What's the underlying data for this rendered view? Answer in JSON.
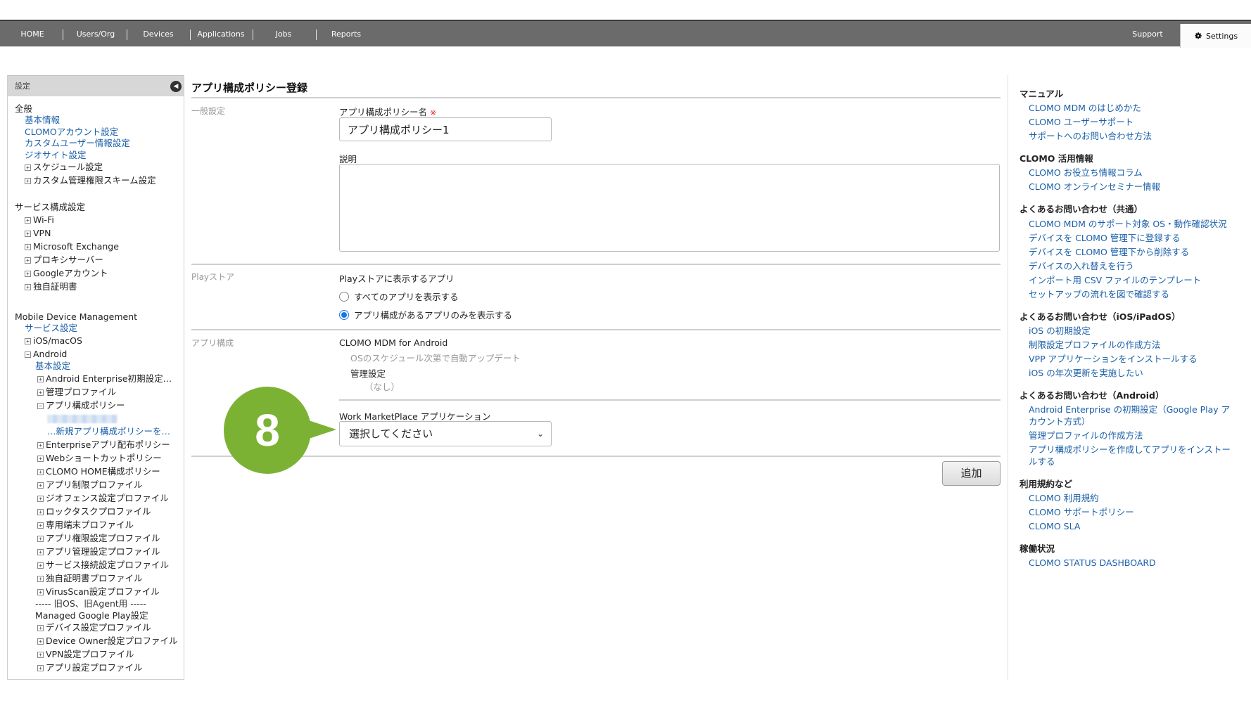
{
  "nav": {
    "items": [
      "HOME",
      "Users/Org",
      "Devices",
      "Applications",
      "Jobs",
      "Reports"
    ],
    "support": "Support",
    "settings": "Settings"
  },
  "sidebar": {
    "header": "設定",
    "general_title": "全般",
    "general_items": [
      "基本情報",
      "CLOMOアカウント設定",
      "カスタムユーザー情報設定",
      "ジオサイト設定"
    ],
    "general_tree": [
      "スケジュール設定",
      "カスタム管理権限スキーム設定"
    ],
    "service_title": "サービス構成設定",
    "service_items": [
      "Wi-Fi",
      "VPN",
      "Microsoft Exchange",
      "プロキシサーバー",
      "Googleアカウント",
      "独自証明書"
    ],
    "mdm_title": "Mobile Device Management",
    "mdm_service": "サービス設定",
    "ios": "iOS/macOS",
    "android": "Android",
    "android_basic": "基本設定",
    "android_items_a": [
      "Android Enterprise初期設定…",
      "管理プロファイル",
      "アプリ構成ポリシー"
    ],
    "new_policy_link": "…新規アプリ構成ポリシーを…",
    "android_items_b": [
      "Enterpriseアプリ配布ポリシー",
      "Webショートカットポリシー",
      "CLOMO HOME構成ポリシー",
      "アプリ制限プロファイル",
      "ジオフェンス設定プロファイル",
      "ロックタスクプロファイル",
      "専用端末プロファイル",
      "アプリ権限設定プロファイル",
      "アプリ管理設定プロファイル",
      "サービス接続設定プロファイル",
      "独自証明書プロファイル",
      "VirusScan設定プロファイル"
    ],
    "legacy_sep": "----- 旧OS、旧Agent用 -----",
    "managed_play": "Managed Google Play設定",
    "android_items_c": [
      "デバイス設定プロファイル",
      "Device Owner設定プロファイル",
      "VPN設定プロファイル",
      "アプリ設定プロファイル"
    ]
  },
  "main": {
    "title": "アプリ構成ポリシー登録",
    "general_section": "一般設定",
    "policy_name_label": "アプリ構成ポリシー名",
    "required_mark": "※",
    "policy_name_value": "アプリ構成ポリシー1",
    "description_label": "説明",
    "description_value": "",
    "play_section": "Playストア",
    "play_label": "Playストアに表示するアプリ",
    "radio_all": "すべてのアプリを表示する",
    "radio_config_only": "アプリ構成があるアプリのみを表示する",
    "radio_selected": "config_only",
    "app_section": "アプリ構成",
    "app_name": "CLOMO MDM for Android",
    "app_update": "OSのスケジュール次第で自動アップデート",
    "managed_label": "管理設定",
    "managed_value": "（なし）",
    "work_label": "Work MarketPlace アプリケーション",
    "work_select": "選択してください",
    "add_button": "追加",
    "step_number": "8",
    "step_color": "#7cb234"
  },
  "right": {
    "sections": [
      {
        "title": "マニュアル",
        "links": [
          "CLOMO MDM のはじめかた",
          "CLOMO ユーザーサポート",
          "サポートへのお問い合わせ方法"
        ]
      },
      {
        "title": "CLOMO 活用情報",
        "links": [
          "CLOMO お役立ち情報コラム",
          "CLOMO オンラインセミナー情報"
        ]
      },
      {
        "title": "よくあるお問い合わせ（共通）",
        "links": [
          "CLOMO MDM のサポート対象 OS・動作確認状況",
          "デバイスを CLOMO 管理下に登録する",
          "デバイスを CLOMO 管理下から削除する",
          "デバイスの入れ替えを行う",
          "インポート用 CSV ファイルのテンプレート",
          "セットアップの流れを図で確認する"
        ]
      },
      {
        "title": "よくあるお問い合わせ（iOS/iPadOS）",
        "links": [
          "iOS の初期設定",
          "制限設定プロファイルの作成方法",
          "VPP アプリケーションをインストールする",
          "iOS の年次更新を実施したい"
        ]
      },
      {
        "title": "よくあるお問い合わせ（Android）",
        "links": [
          "Android Enterprise の初期設定（Google Play アカウント方式）",
          "管理プロファイルの作成方法",
          "アプリ構成ポリシーを作成してアプリをインストールする"
        ]
      },
      {
        "title": "利用規約など",
        "links": [
          "CLOMO 利用規約",
          "CLOMO サポートポリシー",
          "CLOMO SLA"
        ]
      },
      {
        "title": "稼働状況",
        "links": [
          "CLOMO STATUS DASHBOARD"
        ]
      }
    ]
  }
}
